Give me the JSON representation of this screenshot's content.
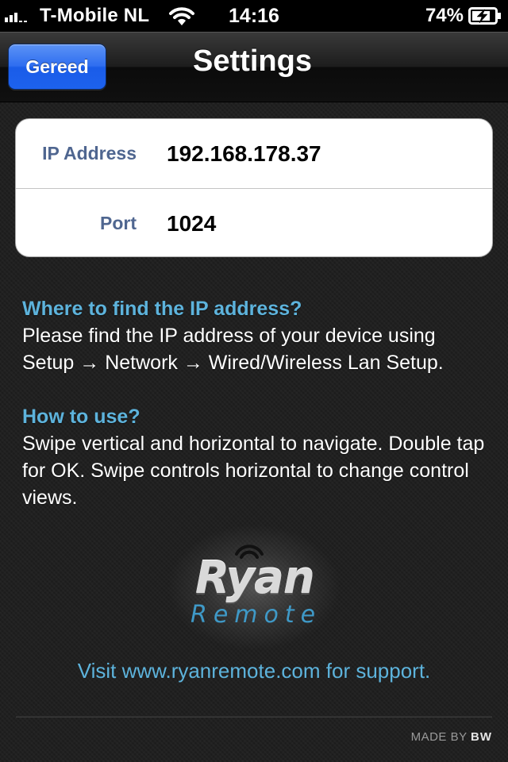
{
  "status_bar": {
    "carrier": "T-Mobile NL",
    "time": "14:16",
    "battery": "74%"
  },
  "nav": {
    "done_label": "Gereed",
    "title": "Settings"
  },
  "settings": {
    "ip_label": "IP Address",
    "ip_value": "192.168.178.37",
    "port_label": "Port",
    "port_value": "1024"
  },
  "help": {
    "where_heading": "Where to find the IP address?",
    "where_body": "Please find the IP address of your device using Setup →  Network →  Wired/Wireless Lan Setup.",
    "how_heading": "How to use?",
    "how_body": "Swipe vertical and horizontal to navigate. Double tap for OK. Swipe controls horizontal to change control views."
  },
  "logo": {
    "word1": "Ryan",
    "word2": "Remote"
  },
  "support_text": "Visit www.ryanremote.com for support.",
  "footer": {
    "made_by": "MADE BY",
    "brand": "BW"
  },
  "colors": {
    "accent_blue": "#5db3dc",
    "button_blue": "#1d62ee",
    "label_blue": "#4f6690"
  }
}
